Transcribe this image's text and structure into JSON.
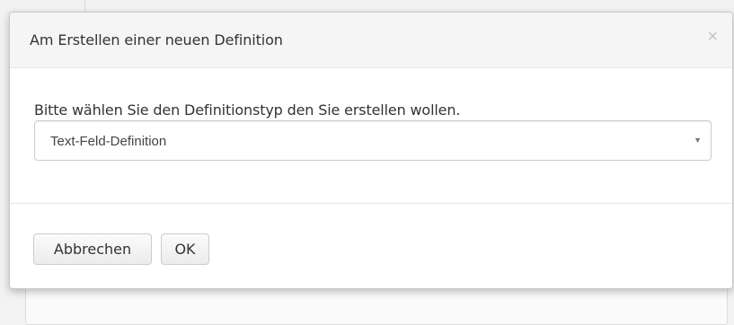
{
  "dialog": {
    "title": "Am Erstellen einer neuen Definition",
    "close_symbol": "×",
    "prompt": "Bitte wählen Sie den Definitionstyp den Sie erstellen wollen.",
    "select": {
      "selected": "Text-Feld-Definition",
      "caret_symbol": "▼"
    },
    "buttons": {
      "cancel_label": "Abbrechen",
      "ok_label": "OK"
    }
  }
}
